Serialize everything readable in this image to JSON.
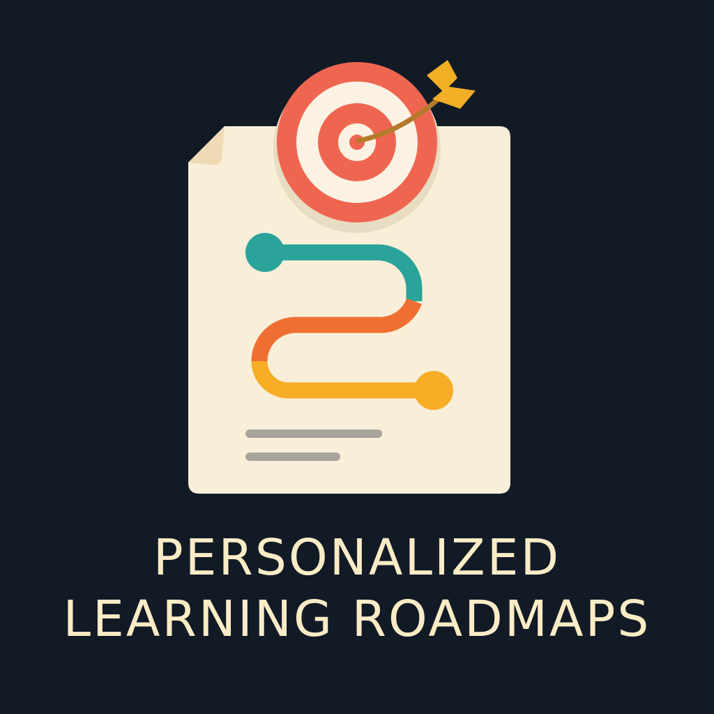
{
  "colors": {
    "background": "#121a26",
    "paper": "#f9efd9",
    "paper_fold": "#f0d9b5",
    "shadow": "#e8dcc2",
    "target_red": "#ef6650",
    "target_white": "#fbf2e3",
    "arrow_shaft": "#b47a2a",
    "arrow_fletch": "#f2ae25",
    "path_teal": "#2aa39a",
    "path_orange": "#ef6f33",
    "path_yellow": "#f7ad26",
    "text_lines": "#a8a39b",
    "title_text": "#fbecc6"
  },
  "icons": {
    "document": "document-icon",
    "target": "target-icon",
    "arrow": "arrow-icon",
    "path": "roadmap-path-icon"
  },
  "title": {
    "line1": "PERSONALIZED",
    "line2": "LEARNING ROADMAPS"
  }
}
